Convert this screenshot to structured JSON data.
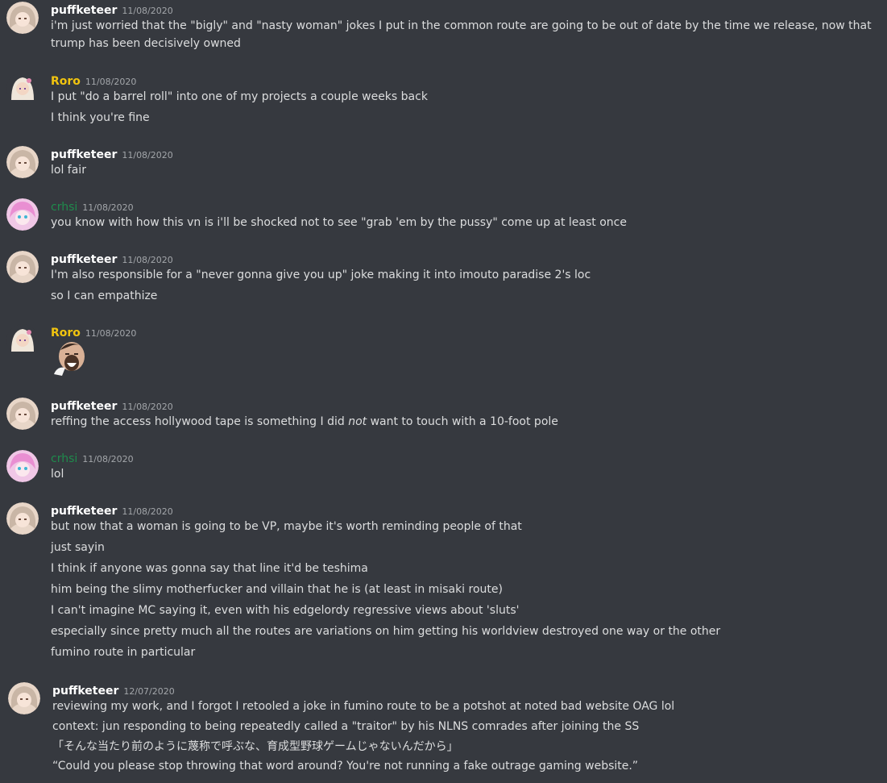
{
  "colors": {
    "background": "#36393f",
    "text": "#dcddde",
    "timestamp": "#a3a6aa",
    "user_puffketeer": "#ffffff",
    "user_roro": "#f1c40f",
    "user_crhsi": "#1f8b4c"
  },
  "messages": [
    {
      "username": "puffketeer",
      "timestamp": "11/08/2020",
      "avatar": "puffketeer-avatar-icon",
      "lines": [
        "i'm just worried that the \"bigly\" and \"nasty woman\" jokes I put in the common route are going to be out of date by the time we release, now that trump has been decisively owned"
      ]
    },
    {
      "username": "Roro",
      "timestamp": "11/08/2020",
      "avatar": "roro-avatar-icon",
      "lines": [
        "I put \"do a barrel roll\" into one of my projects a couple weeks back",
        "I think you're fine"
      ]
    },
    {
      "username": "puffketeer",
      "timestamp": "11/08/2020",
      "avatar": "puffketeer-avatar-icon",
      "lines": [
        "lol fair"
      ]
    },
    {
      "username": "crhsi",
      "timestamp": "11/08/2020",
      "avatar": "crhsi-avatar-icon",
      "lines": [
        "you know with how this vn is i'll be shocked not to see \"grab 'em by the pussy\" come up at least once"
      ]
    },
    {
      "username": "puffketeer",
      "timestamp": "11/08/2020",
      "avatar": "puffketeer-avatar-icon",
      "lines": [
        "I'm also responsible for a \"never gonna give you up\" joke making it into imouto paradise 2's loc",
        "so I can empathize"
      ]
    },
    {
      "username": "Roro",
      "timestamp": "11/08/2020",
      "avatar": "roro-avatar-icon",
      "emoji": "laughing-face-emoji-icon"
    },
    {
      "username": "puffketeer",
      "timestamp": "11/08/2020",
      "avatar": "puffketeer-avatar-icon",
      "lines_rich": {
        "before": "reffing the access hollywood tape is something I did ",
        "emphasis": "not",
        "after": " want to touch with a 10-foot pole"
      }
    },
    {
      "username": "crhsi",
      "timestamp": "11/08/2020",
      "avatar": "crhsi-avatar-icon",
      "lines": [
        "lol"
      ]
    },
    {
      "username": "puffketeer",
      "timestamp": "11/08/2020",
      "avatar": "puffketeer-avatar-icon",
      "lines": [
        "but now that a woman is going to be VP, maybe it's worth reminding people of that",
        "just sayin",
        "I think if anyone was gonna say that line it'd be teshima",
        "him being the slimy motherfucker and villain that he is (at least in misaki route)",
        "I can't imagine MC saying it, even with his edgelordy regressive views about 'sluts'",
        "especially since pretty much all the routes are variations on him getting his worldview destroyed one way or the other",
        "fumino route in particular"
      ]
    },
    {
      "username": "puffketeer",
      "timestamp": "12/07/2020",
      "avatar": "puffketeer-avatar-icon",
      "lines": [
        "reviewing my work, and I forgot I retooled a joke in fumino route to be a potshot at noted bad website OAG lol",
        "context: jun responding to being repeatedly called a \"traitor\" by his NLNS comrades after joining the SS",
        "「そんな当たり前のように蔑称で呼ぶな、育成型野球ゲームじゃないんだから」",
        "“Could you please stop throwing that word around? You're not running a fake outrage gaming website.”"
      ]
    }
  ]
}
